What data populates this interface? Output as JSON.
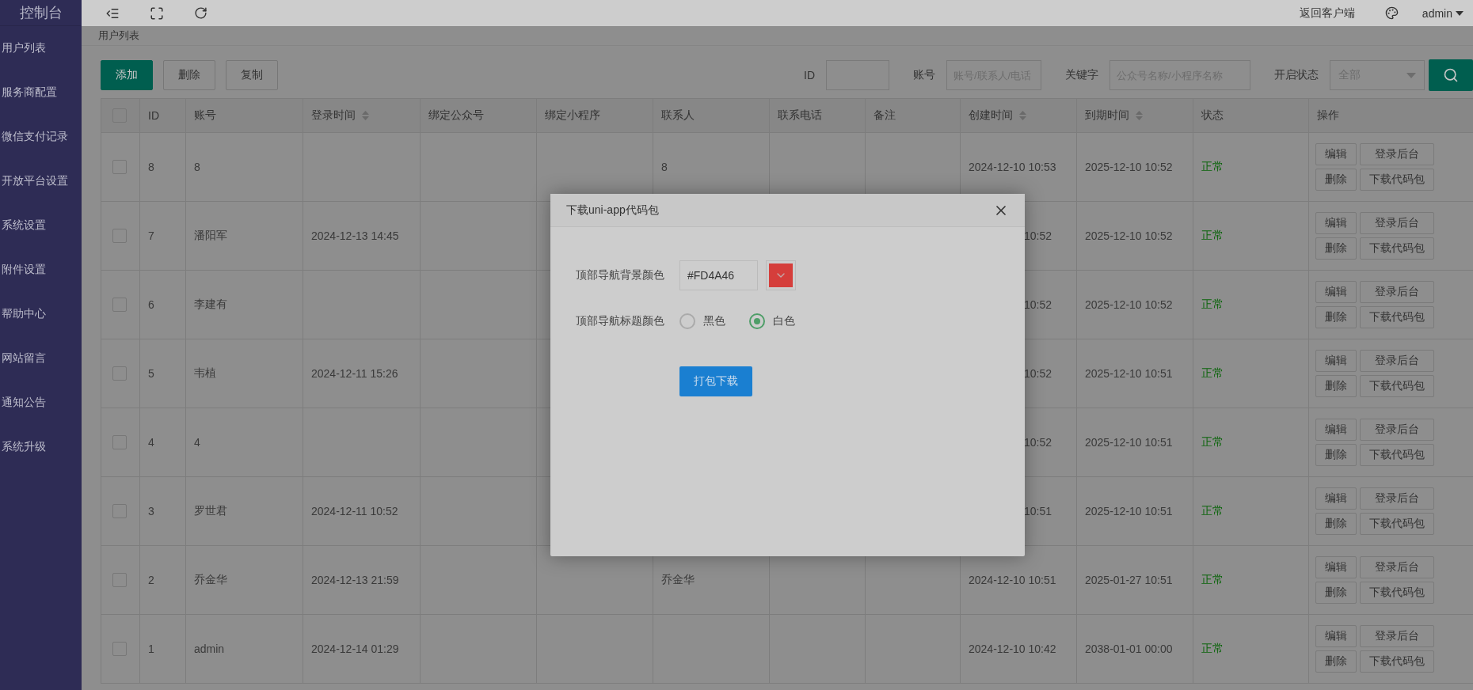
{
  "sidebar": {
    "logo": "控制台",
    "items": [
      {
        "label": "用户列表"
      },
      {
        "label": "服务商配置"
      },
      {
        "label": "微信支付记录"
      },
      {
        "label": "开放平台设置"
      },
      {
        "label": "系统设置"
      },
      {
        "label": "附件设置"
      },
      {
        "label": "帮助中心"
      },
      {
        "label": "网站留言"
      },
      {
        "label": "通知公告"
      },
      {
        "label": "系统升级"
      }
    ]
  },
  "topbar": {
    "return_link": "返回客户端",
    "user": "admin"
  },
  "breadcrumb": "用户列表",
  "toolbar": {
    "buttons": [
      {
        "label": "添加",
        "kind": "primary"
      },
      {
        "label": "删除",
        "kind": "plain"
      },
      {
        "label": "复制",
        "kind": "plain"
      }
    ],
    "filters": [
      {
        "label": "ID",
        "kind": "input"
      },
      {
        "label": "账号",
        "kind": "input",
        "placeholder": "账号/联系人/电话"
      },
      {
        "label": "关键字",
        "kind": "input",
        "placeholder": "公众号名称/小程序名称"
      },
      {
        "label": "开启状态",
        "kind": "select",
        "value": "全部"
      }
    ]
  },
  "table": {
    "select_all_checked": false,
    "columns": [
      {
        "label": "ID"
      },
      {
        "label": "账号"
      },
      {
        "label": "登录时间",
        "sortable": true
      },
      {
        "label": "绑定公众号"
      },
      {
        "label": "绑定小程序"
      },
      {
        "label": "联系人"
      },
      {
        "label": "联系电话"
      },
      {
        "label": "备注"
      },
      {
        "label": "创建时间",
        "sortable": true
      },
      {
        "label": "到期时间",
        "sortable": true
      },
      {
        "label": "状态"
      },
      {
        "label": "操作"
      }
    ],
    "rows": [
      {
        "checked": false,
        "id": "8",
        "account": "8",
        "contact": "8",
        "created": "2024-12-10 10:53",
        "expires": "2025-12-10 10:52",
        "status": "正常",
        "covered": false,
        "actions": [
          "编辑",
          "登录后台",
          "删除",
          "下载代码包"
        ]
      },
      {
        "checked": false,
        "id": "7",
        "account": "潘阳军",
        "login": "2024-12-13 14:45",
        "created": "10:52",
        "expires": "2025-12-10 10:52",
        "status": "正常",
        "covered": true,
        "actions": [
          "编辑",
          "登录后台",
          "删除",
          "下载代码包"
        ]
      },
      {
        "checked": false,
        "id": "6",
        "account": "李建有",
        "created": "10:52",
        "expires": "2025-12-10 10:52",
        "status": "正常",
        "covered": true,
        "actions": [
          "编辑",
          "登录后台",
          "删除",
          "下载代码包"
        ]
      },
      {
        "checked": false,
        "id": "5",
        "account": "韦植",
        "login": "2024-12-11 15:26",
        "created": "10:52",
        "expires": "2025-12-10 10:51",
        "status": "正常",
        "covered": true,
        "actions": [
          "编辑",
          "登录后台",
          "删除",
          "下载代码包"
        ]
      },
      {
        "checked": false,
        "id": "4",
        "account": "4",
        "created": "10:52",
        "expires": "2025-12-10 10:51",
        "status": "正常",
        "covered": true,
        "actions": [
          "编辑",
          "登录后台",
          "删除",
          "下载代码包"
        ]
      },
      {
        "checked": false,
        "id": "3",
        "account": "罗世君",
        "login": "2024-12-11 10:52",
        "created": "10:51",
        "expires": "2025-12-10 10:51",
        "status": "正常",
        "covered": true,
        "actions": [
          "编辑",
          "登录后台",
          "删除",
          "下载代码包"
        ]
      },
      {
        "checked": false,
        "id": "2",
        "account": "乔金华",
        "login": "2024-12-13 21:59",
        "contact": "乔金华",
        "created": "2024-12-10 10:51",
        "expires": "2025-01-27 10:51",
        "status": "正常",
        "covered": false,
        "actions": [
          "编辑",
          "登录后台",
          "删除",
          "下载代码包"
        ]
      },
      {
        "checked": false,
        "id": "1",
        "account": "admin",
        "login": "2024-12-14 01:29",
        "created": "2024-12-10 10:42",
        "expires": "2038-01-01 00:00",
        "status": "正常",
        "covered": false,
        "actions": [
          "编辑",
          "登录后台",
          "删除",
          "下载代码包"
        ]
      }
    ]
  },
  "dialog": {
    "title": "下载uni-app代码包",
    "bg_color": {
      "label": "顶部导航背景颜色",
      "value": "#FD4A46"
    },
    "title_color": {
      "label": "顶部导航标题颜色",
      "options": [
        {
          "label": "黑色",
          "selected": false
        },
        {
          "label": "白色",
          "selected": true
        }
      ]
    },
    "submit": "打包下载"
  }
}
